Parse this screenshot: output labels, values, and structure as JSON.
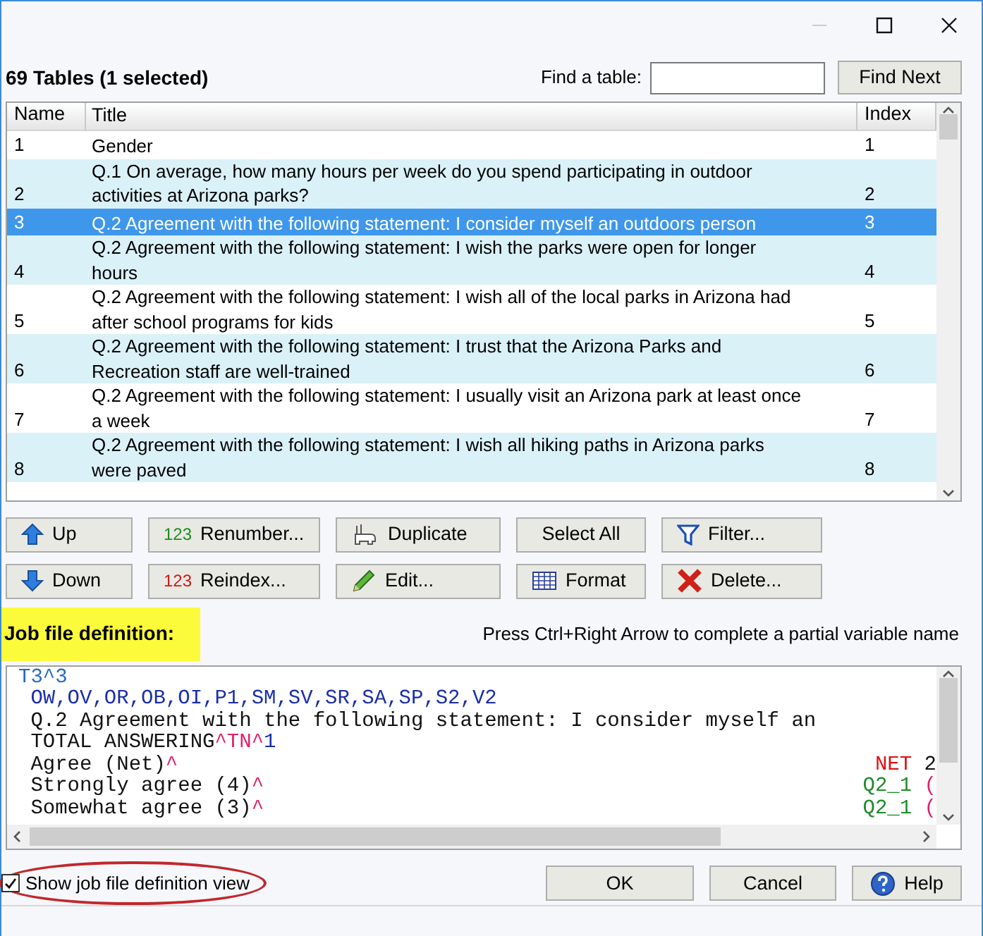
{
  "header": {
    "count_label": "69 Tables  (1 selected)",
    "find_label": "Find a table:",
    "find_button": "Find Next"
  },
  "table": {
    "columns": [
      "Name",
      "Title",
      "Index"
    ],
    "rows": [
      {
        "name": "1",
        "title": "Gender",
        "index": "1",
        "selected": false
      },
      {
        "name": "2",
        "title": "Q.1 On average, how many hours per week do you spend participating in outdoor activities at Arizona parks?",
        "index": "2",
        "selected": false
      },
      {
        "name": "3",
        "title": "Q.2 Agreement with the following statement: I consider myself an outdoors person",
        "index": "3",
        "selected": true
      },
      {
        "name": "4",
        "title": "Q.2 Agreement with the following statement: I wish the parks were open for longer hours",
        "index": "4",
        "selected": false
      },
      {
        "name": "5",
        "title": "Q.2 Agreement with the following statement: I wish all of the local parks in Arizona had after school programs for kids",
        "index": "5",
        "selected": false
      },
      {
        "name": "6",
        "title": "Q.2 Agreement with the following statement: I trust that the Arizona Parks and Recreation staff are well-trained",
        "index": "6",
        "selected": false
      },
      {
        "name": "7",
        "title": "Q.2 Agreement with the following statement: I usually visit an Arizona park at least once a week",
        "index": "7",
        "selected": false
      },
      {
        "name": "8",
        "title": "Q.2 Agreement with the following statement: I wish all hiking paths in Arizona parks were paved",
        "index": "8",
        "selected": false
      }
    ]
  },
  "actions": [
    {
      "label": "Up"
    },
    {
      "label": "Renumber...",
      "badge_text": "123"
    },
    {
      "label": "Duplicate"
    },
    {
      "label": "Select All"
    },
    {
      "label": "Filter..."
    },
    {
      "label": "Down"
    },
    {
      "label": "Reindex...",
      "badge_text": "123"
    },
    {
      "label": "Edit..."
    },
    {
      "label": "Format"
    },
    {
      "label": "Delete..."
    }
  ],
  "definition": {
    "label": "Job file definition:",
    "hint": "Press Ctrl+Right Arrow to complete a partial variable name",
    "lines": [
      {
        "left": [
          {
            "text": "T3",
            "kind": "keyword"
          },
          {
            "text": "^3",
            "kind": "keyword"
          }
        ]
      },
      {
        "left": [
          {
            "text": " OW,OV,OR,OB,OI,P1,SM,SV,SR,SA,SP,S2,V2",
            "kind": "list"
          }
        ]
      },
      {
        "left": [
          {
            "text": " Q.2 Agreement with the following statement: I consider myself an",
            "kind": "plain"
          }
        ]
      },
      {
        "left": [
          {
            "text": " TOTAL ANSWERING",
            "kind": "plain"
          },
          {
            "text": "^TN^",
            "kind": "marker"
          },
          {
            "text": "1",
            "kind": "list"
          }
        ]
      },
      {
        "left": [
          {
            "text": " Agree (Net)",
            "kind": "plain"
          },
          {
            "text": "^",
            "kind": "marker"
          }
        ],
        "right": [
          {
            "text": "NET",
            "kind": "net"
          },
          {
            "text": " 2",
            "kind": "plain"
          }
        ]
      },
      {
        "left": [
          {
            "text": " Strongly agree (4)",
            "kind": "plain"
          },
          {
            "text": "^",
            "kind": "marker"
          }
        ],
        "right": [
          {
            "text": "Q2_1",
            "kind": "variable"
          },
          {
            "text": " (",
            "kind": "marker"
          }
        ]
      },
      {
        "left": [
          {
            "text": " Somewhat agree (3)",
            "kind": "plain"
          },
          {
            "text": "^",
            "kind": "marker"
          }
        ],
        "right": [
          {
            "text": "Q2_1",
            "kind": "variable"
          },
          {
            "text": " (",
            "kind": "marker"
          }
        ]
      }
    ]
  },
  "show_definition": {
    "label": "Show job file definition view",
    "checked": true
  },
  "buttons": [
    "OK",
    "Cancel",
    "Help"
  ]
}
